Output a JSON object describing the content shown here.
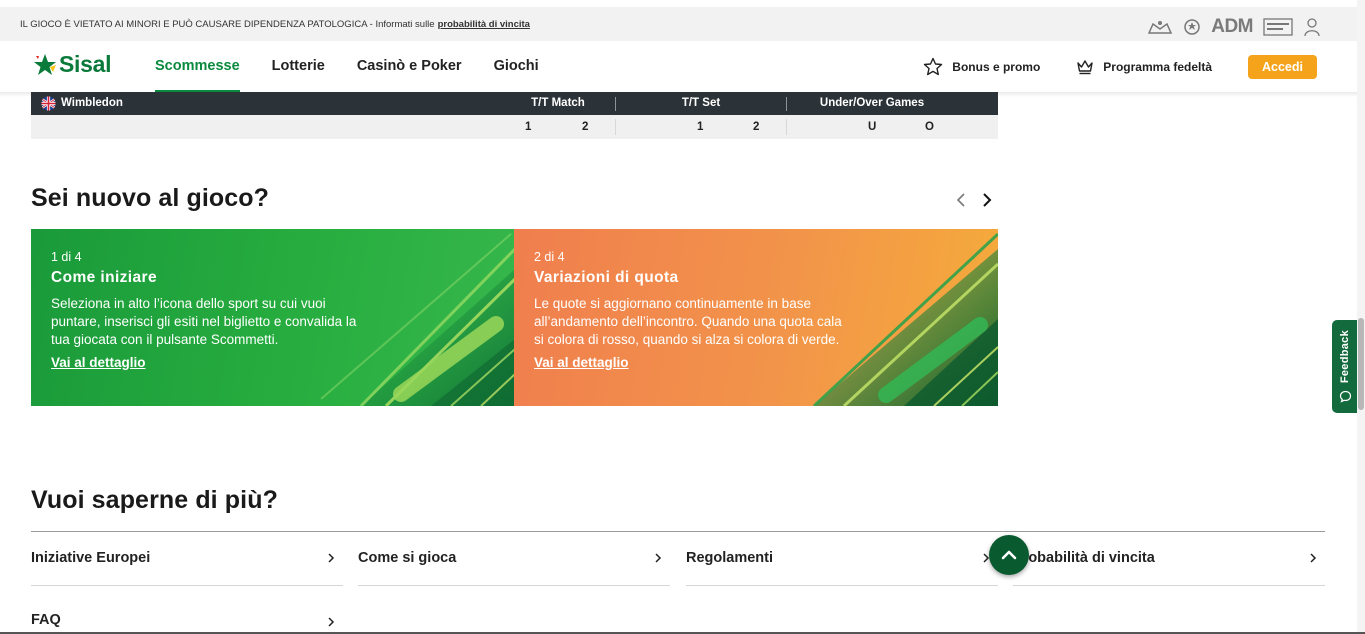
{
  "warning": {
    "text": "IL GIOCO È VIETATO AI MINORI E PUÒ CAUSARE DIPENDENZA PATOLOGICA - Informati sulle",
    "link": "probabilità di vincita",
    "adm": "ADM"
  },
  "header": {
    "logo": "Sisal",
    "nav": [
      "Scommesse",
      "Lotterie",
      "Casinò e Poker",
      "Giochi"
    ],
    "bonus": "Bonus e promo",
    "loyalty": "Programma fedeltà",
    "login": "Accedi"
  },
  "table": {
    "event": "Wimbledon",
    "markets": [
      {
        "label": "T/T Match",
        "outcomes": [
          "1",
          "2"
        ]
      },
      {
        "label": "T/T Set",
        "outcomes": [
          "1",
          "2"
        ]
      },
      {
        "label": "Under/Over Games",
        "outcomes": [
          "U",
          "O"
        ]
      }
    ]
  },
  "newbie": {
    "title": "Sei nuovo al gioco?",
    "cards": [
      {
        "count": "1 di 4",
        "title": "Come iniziare",
        "desc": "Seleziona in alto l’icona dello sport su cui vuoi puntare, inserisci gli esiti nel biglietto e convalida la tua giocata con il pulsante Scommetti.",
        "link": "Vai al dettaglio"
      },
      {
        "count": "2 di 4",
        "title": "Variazioni di quota",
        "desc": "Le quote si aggiornano continuamente in base all’andamento dell’incontro. Quando una quota cala si colora di rosso, quando si alza si colora di verde.",
        "link": "Vai al dettaglio"
      }
    ]
  },
  "more": {
    "title": "Vuoi saperne di più?",
    "links": [
      "Iniziative Europei",
      "Come si gioca",
      "Regolamenti",
      "Probabilità di vincita",
      "FAQ"
    ]
  },
  "feedback": "Feedback",
  "colors": {
    "brand_green": "#0a8a3e",
    "accent_orange": "#f5a31a",
    "table_header": "#2c3338"
  }
}
